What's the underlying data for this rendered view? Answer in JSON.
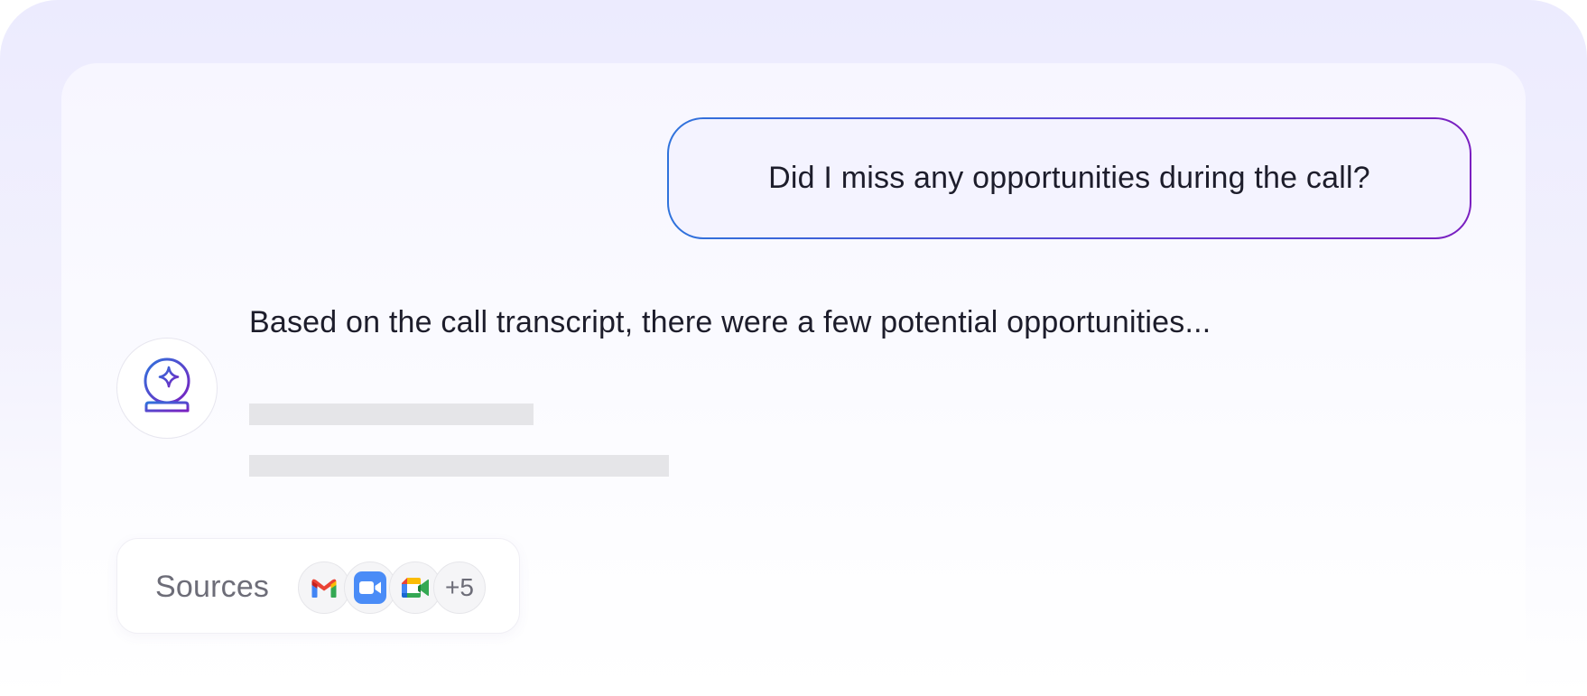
{
  "chat": {
    "user_message": "Did I miss any opportunities during the call?",
    "assistant": {
      "avatar_icon": "crystal-ball-sparkle-icon",
      "answer_text": "Based on the call transcript, there were a few potential opportunities...",
      "loading_lines": 2
    }
  },
  "sources": {
    "label": "Sources",
    "icons": [
      "gmail-icon",
      "zoom-icon",
      "google-meet-icon"
    ],
    "more_count": "+5"
  },
  "colors": {
    "bubble_gradient_start": "#2f73dc",
    "bubble_gradient_end": "#7a1fc0",
    "text": "#1d1d2b",
    "muted_text": "#6d6d78",
    "skeleton": "#e5e5e8"
  }
}
